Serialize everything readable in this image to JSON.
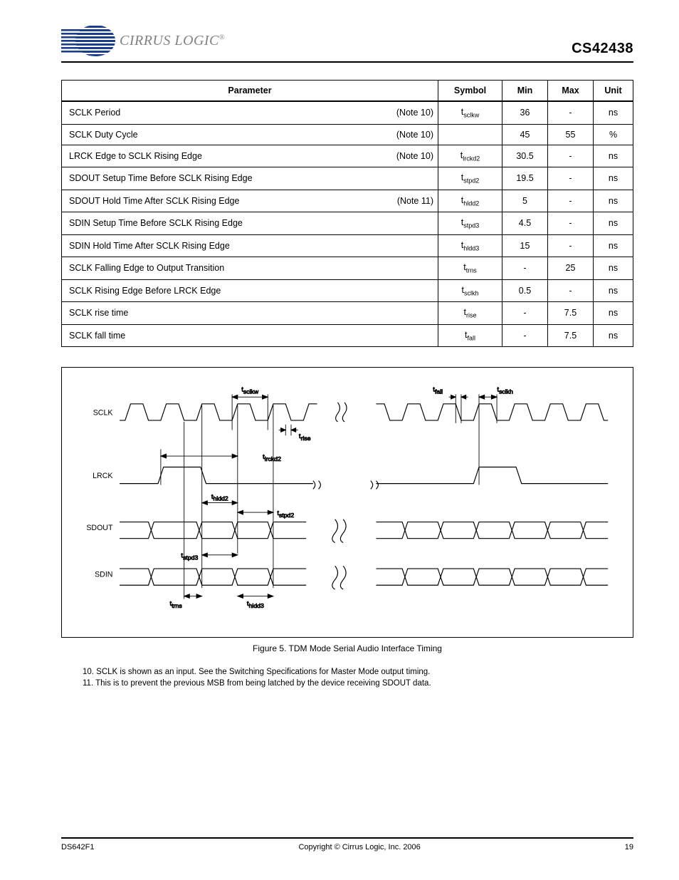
{
  "header": {
    "brand": "CIRRUS LOGIC",
    "part": "CS42438"
  },
  "table": {
    "headers": [
      "Parameter",
      "Symbol",
      "Min",
      "Max",
      "Unit"
    ],
    "rows": [
      {
        "param": "SCLK Period",
        "note": "(Note 10)",
        "sym": "t_sclkw",
        "min": "36",
        "max": "-",
        "unit": "ns"
      },
      {
        "param": "SCLK Duty Cycle",
        "note": "(Note 10)",
        "sym": "",
        "min": "45",
        "max": "55",
        "unit": "%"
      },
      {
        "param": "LRCK Edge to SCLK Rising Edge",
        "note": "(Note 10)",
        "sym": "t_lrckd2",
        "min": "30.5",
        "max": "-",
        "unit": "ns"
      },
      {
        "param": "SDOUT Setup Time Before SCLK Rising Edge",
        "note": "",
        "sym": "t_stpd2",
        "min": "19.5",
        "max": "-",
        "unit": "ns"
      },
      {
        "param": "SDOUT Hold Time After SCLK Rising Edge",
        "note": "(Note 11)",
        "sym": "t_hldd2",
        "min": "5",
        "max": "-",
        "unit": "ns"
      },
      {
        "param": "SDIN Setup Time Before SCLK Rising Edge",
        "note": "",
        "sym": "t_stpd3",
        "min": "4.5",
        "max": "-",
        "unit": "ns"
      },
      {
        "param": "SDIN Hold Time After SCLK Rising Edge",
        "note": "",
        "sym": "t_hldd3",
        "min": "15",
        "max": "-",
        "unit": "ns"
      },
      {
        "param": "SCLK Falling Edge to Output Transition",
        "note": "",
        "sym": "t_trns",
        "min": "-",
        "max": "25",
        "unit": "ns"
      },
      {
        "param": "SCLK Rising Edge Before LRCK Edge",
        "note": "",
        "sym": "t_sclkh",
        "min": "0.5",
        "max": "-",
        "unit": "ns"
      },
      {
        "param": "SCLK rise time",
        "note": "",
        "sym": "t_rise",
        "min": "-",
        "max": "7.5",
        "unit": "ns"
      },
      {
        "param": "SCLK fall time",
        "note": "",
        "sym": "t_fall",
        "min": "-",
        "max": "7.5",
        "unit": "ns"
      }
    ]
  },
  "figure": {
    "caption": "Figure 5.  TDM Mode Serial Audio Interface Timing",
    "signals": [
      "SCLK",
      "LRCK",
      "SDOUT",
      "SDIN"
    ],
    "labels": {
      "tsclkw": "t_sclkw",
      "trise": "t_rise",
      "tfall": "t_fall",
      "tsclkh": "t_sclkh",
      "tlrckd2": "t_lrckd2",
      "thldd2": "t_hldd2",
      "tstpd2": "t_stpd2",
      "tstpd3": "t_stpd3",
      "thldd3": "t_hldd3",
      "ttrns": "t_trns"
    }
  },
  "notes": [
    "10. SCLK is shown as an input. See the Switching Specifications for Master Mode output timing.",
    "11. This is to prevent the previous MSB from being latched by the device receiving SDOUT data."
  ],
  "footer": {
    "left": "DS642F1",
    "center": "Copyright © Cirrus Logic, Inc. 2006",
    "right": "19"
  }
}
